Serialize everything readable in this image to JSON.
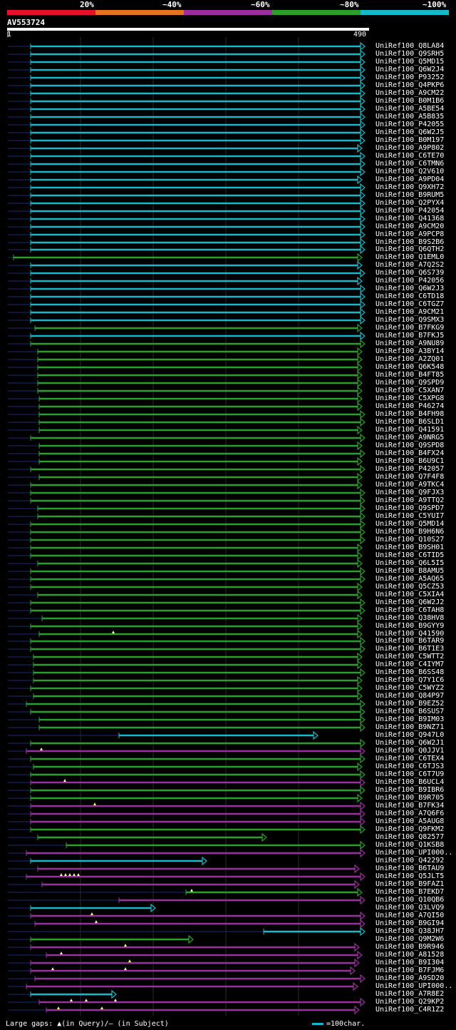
{
  "legend": {
    "colors": [
      "#e8102a",
      "#e8731e",
      "#9b2fa0",
      "#2aa02a",
      "#17b9c9"
    ],
    "labels": [
      "20%",
      "~40%",
      "~60%",
      "~80%",
      "~100%"
    ]
  },
  "query": {
    "name": "AV553724",
    "start": "1",
    "end": "490"
  },
  "footer": {
    "gaps_text": "Large gaps: ▲(in Query)/— (in Subject)",
    "scale_text": "=100char."
  },
  "hits": [
    {
      "label": "UniRef100_Q8LA84",
      "c": 4,
      "s": 43,
      "e": 512
    },
    {
      "label": "UniRef100_Q9SRH5",
      "c": 4,
      "s": 43,
      "e": 512
    },
    {
      "label": "UniRef100_Q5MD15",
      "c": 4,
      "s": 43,
      "e": 512
    },
    {
      "label": "UniRef100_Q6W2J4",
      "c": 4,
      "s": 43,
      "e": 512
    },
    {
      "label": "UniRef100_P93252",
      "c": 4,
      "s": 43,
      "e": 512
    },
    {
      "label": "UniRef100_Q4PKP6",
      "c": 4,
      "s": 43,
      "e": 512
    },
    {
      "label": "UniRef100_A9CM22",
      "c": 4,
      "s": 43,
      "e": 512
    },
    {
      "label": "UniRef100_B0M1B6",
      "c": 4,
      "s": 43,
      "e": 512
    },
    {
      "label": "UniRef100_A5BE54",
      "c": 4,
      "s": 43,
      "e": 512
    },
    {
      "label": "UniRef100_A5B835",
      "c": 4,
      "s": 43,
      "e": 512
    },
    {
      "label": "UniRef100_P42055",
      "c": 4,
      "s": 43,
      "e": 512
    },
    {
      "label": "UniRef100_Q6W2J5",
      "c": 4,
      "s": 43,
      "e": 512
    },
    {
      "label": "UniRef100_B0M197",
      "c": 4,
      "s": 43,
      "e": 512
    },
    {
      "label": "UniRef100_A9P802",
      "c": 4,
      "s": 43,
      "e": 508
    },
    {
      "label": "UniRef100_C6TE70",
      "c": 4,
      "s": 43,
      "e": 512
    },
    {
      "label": "UniRef100_C6TMN6",
      "c": 4,
      "s": 43,
      "e": 512
    },
    {
      "label": "UniRef100_Q2V610",
      "c": 4,
      "s": 43,
      "e": 512
    },
    {
      "label": "UniRef100_A9PD04",
      "c": 4,
      "s": 43,
      "e": 508
    },
    {
      "label": "UniRef100_Q9XH72",
      "c": 4,
      "s": 43,
      "e": 512
    },
    {
      "label": "UniRef100_B9RUM5",
      "c": 4,
      "s": 43,
      "e": 512
    },
    {
      "label": "UniRef100_Q2PYX4",
      "c": 4,
      "s": 43,
      "e": 512
    },
    {
      "label": "UniRef100_P42054",
      "c": 4,
      "s": 43,
      "e": 512
    },
    {
      "label": "UniRef100_Q41368",
      "c": 4,
      "s": 43,
      "e": 512
    },
    {
      "label": "UniRef100_A9CM20",
      "c": 4,
      "s": 43,
      "e": 512
    },
    {
      "label": "UniRef100_A9PCP8",
      "c": 4,
      "s": 43,
      "e": 512
    },
    {
      "label": "UniRef100_B9S2B6",
      "c": 4,
      "s": 43,
      "e": 512
    },
    {
      "label": "UniRef100_Q6QTH2",
      "c": 4,
      "s": 43,
      "e": 512
    },
    {
      "label": "UniRef100_Q1EML0",
      "c": 3,
      "s": 19,
      "e": 508
    },
    {
      "label": "UniRef100_A7Q2S2",
      "c": 4,
      "s": 43,
      "e": 508
    },
    {
      "label": "UniRef100_Q6S739",
      "c": 4,
      "s": 43,
      "e": 512
    },
    {
      "label": "UniRef100_P42056",
      "c": 4,
      "s": 43,
      "e": 508
    },
    {
      "label": "UniRef100_Q6W2J3",
      "c": 4,
      "s": 43,
      "e": 512
    },
    {
      "label": "UniRef100_C6TD18",
      "c": 4,
      "s": 43,
      "e": 512
    },
    {
      "label": "UniRef100_C6TGZ7",
      "c": 4,
      "s": 43,
      "e": 512
    },
    {
      "label": "UniRef100_A9CM21",
      "c": 4,
      "s": 43,
      "e": 512
    },
    {
      "label": "UniRef100_Q9SMX3",
      "c": 4,
      "s": 43,
      "e": 512
    },
    {
      "label": "UniRef100_B7FKG9",
      "c": 3,
      "s": 49,
      "e": 508
    },
    {
      "label": "UniRef100_B7FKJ5",
      "c": 4,
      "s": 43,
      "e": 512
    },
    {
      "label": "UniRef100_A9NU89",
      "c": 3,
      "s": 43,
      "e": 512
    },
    {
      "label": "UniRef100_A3BY14",
      "c": 3,
      "s": 53,
      "e": 508
    },
    {
      "label": "UniRef100_A2ZQ01",
      "c": 3,
      "s": 53,
      "e": 508
    },
    {
      "label": "UniRef100_Q6K548",
      "c": 3,
      "s": 53,
      "e": 508
    },
    {
      "label": "UniRef100_B4FT85",
      "c": 3,
      "s": 53,
      "e": 508
    },
    {
      "label": "UniRef100_Q9SPD9",
      "c": 3,
      "s": 53,
      "e": 508
    },
    {
      "label": "UniRef100_C5XAN7",
      "c": 3,
      "s": 53,
      "e": 508
    },
    {
      "label": "UniRef100_C5XPG8",
      "c": 3,
      "s": 55,
      "e": 508
    },
    {
      "label": "UniRef100_P46274",
      "c": 3,
      "s": 55,
      "e": 508
    },
    {
      "label": "UniRef100_B4FH98",
      "c": 3,
      "s": 55,
      "e": 512
    },
    {
      "label": "UniRef100_B6SLD1",
      "c": 3,
      "s": 55,
      "e": 512
    },
    {
      "label": "UniRef100_Q41591",
      "c": 3,
      "s": 55,
      "e": 508
    },
    {
      "label": "UniRef100_A9NRG5",
      "c": 3,
      "s": 43,
      "e": 512
    },
    {
      "label": "UniRef100_Q9SPD8",
      "c": 3,
      "s": 55,
      "e": 508
    },
    {
      "label": "UniRef100_B4FX24",
      "c": 3,
      "s": 55,
      "e": 512
    },
    {
      "label": "UniRef100_B6U9C1",
      "c": 3,
      "s": 55,
      "e": 508
    },
    {
      "label": "UniRef100_P42057",
      "c": 3,
      "s": 43,
      "e": 512
    },
    {
      "label": "UniRef100_Q7F4F8",
      "c": 3,
      "s": 55,
      "e": 508
    },
    {
      "label": "UniRef100_A9TKC4",
      "c": 3,
      "s": 43,
      "e": 508
    },
    {
      "label": "UniRef100_Q9FJX3",
      "c": 3,
      "s": 43,
      "e": 512
    },
    {
      "label": "UniRef100_A9TTQ2",
      "c": 3,
      "s": 43,
      "e": 512
    },
    {
      "label": "UniRef100_Q9SPD7",
      "c": 3,
      "s": 53,
      "e": 512
    },
    {
      "label": "UniRef100_C5YUI7",
      "c": 3,
      "s": 53,
      "e": 512
    },
    {
      "label": "UniRef100_Q5MD14",
      "c": 3,
      "s": 43,
      "e": 512
    },
    {
      "label": "UniRef100_B9H6N6",
      "c": 3,
      "s": 43,
      "e": 512
    },
    {
      "label": "UniRef100_Q10S27",
      "c": 3,
      "s": 43,
      "e": 512
    },
    {
      "label": "UniRef100_B9SH01",
      "c": 3,
      "s": 43,
      "e": 508
    },
    {
      "label": "UniRef100_C6TID5",
      "c": 3,
      "s": 43,
      "e": 508
    },
    {
      "label": "UniRef100_Q6L5I5",
      "c": 3,
      "s": 53,
      "e": 508
    },
    {
      "label": "UniRef100_B8AMU5",
      "c": 3,
      "s": 43,
      "e": 512
    },
    {
      "label": "UniRef100_A5AQ65",
      "c": 3,
      "s": 43,
      "e": 512
    },
    {
      "label": "UniRef100_Q5CZ53",
      "c": 3,
      "s": 43,
      "e": 508
    },
    {
      "label": "UniRef100_C5XIA4",
      "c": 3,
      "s": 53,
      "e": 508
    },
    {
      "label": "UniRef100_Q6W2J2",
      "c": 3,
      "s": 43,
      "e": 512
    },
    {
      "label": "UniRef100_C6TAH8",
      "c": 3,
      "s": 43,
      "e": 512
    },
    {
      "label": "UniRef100_Q38HV8",
      "c": 3,
      "s": 59,
      "e": 508
    },
    {
      "label": "UniRef100_B9GYY9",
      "c": 3,
      "s": 43,
      "e": 508
    },
    {
      "label": "UniRef100_Q41590",
      "c": 3,
      "s": 55,
      "e": 508,
      "mk": [
        159
      ]
    },
    {
      "label": "UniRef100_B6TAR9",
      "c": 3,
      "s": 43,
      "e": 512
    },
    {
      "label": "UniRef100_B6T1E3",
      "c": 3,
      "s": 43,
      "e": 512
    },
    {
      "label": "UniRef100_C5WTT2",
      "c": 3,
      "s": 47,
      "e": 508
    },
    {
      "label": "UniRef100_C4IYM7",
      "c": 3,
      "s": 47,
      "e": 508
    },
    {
      "label": "UniRef100_B6SS48",
      "c": 3,
      "s": 47,
      "e": 512
    },
    {
      "label": "UniRef100_Q7Y1C6",
      "c": 3,
      "s": 47,
      "e": 508
    },
    {
      "label": "UniRef100_C5WYZ2",
      "c": 3,
      "s": 43,
      "e": 508
    },
    {
      "label": "UniRef100_Q84P97",
      "c": 3,
      "s": 47,
      "e": 508
    },
    {
      "label": "UniRef100_B9EZ52",
      "c": 3,
      "s": 37,
      "e": 512
    },
    {
      "label": "UniRef100_B6SUS7",
      "c": 3,
      "s": 43,
      "e": 512
    },
    {
      "label": "UniRef100_B9IM03",
      "c": 3,
      "s": 55,
      "e": 512
    },
    {
      "label": "UniRef100_B9NZ71",
      "c": 3,
      "s": 55,
      "e": 512
    },
    {
      "label": "UniRef100_Q947L0",
      "c": 4,
      "s": 167,
      "e": 446
    },
    {
      "label": "UniRef100_Q6W2J1",
      "c": 3,
      "s": 43,
      "e": 512
    },
    {
      "label": "UniRef100_Q0JJV1",
      "c": 2,
      "s": 37,
      "e": 512,
      "mk": [
        58
      ]
    },
    {
      "label": "UniRef100_C6TEX4",
      "c": 3,
      "s": 43,
      "e": 512
    },
    {
      "label": "UniRef100_C6TJS3",
      "c": 3,
      "s": 47,
      "e": 508
    },
    {
      "label": "UniRef100_C6T7U9",
      "c": 3,
      "s": 43,
      "e": 512
    },
    {
      "label": "UniRef100_B6UCL4",
      "c": 2,
      "s": 43,
      "e": 512,
      "mk": [
        91
      ]
    },
    {
      "label": "UniRef100_B9IBR6",
      "c": 3,
      "s": 43,
      "e": 512
    },
    {
      "label": "UniRef100_B9R705",
      "c": 3,
      "s": 43,
      "e": 508
    },
    {
      "label": "UniRef100_B7FK34",
      "c": 2,
      "s": 43,
      "e": 512,
      "mk": [
        133
      ]
    },
    {
      "label": "UniRef100_A7Q6F6",
      "c": 2,
      "s": 43,
      "e": 512
    },
    {
      "label": "UniRef100_A5AUG8",
      "c": 2,
      "s": 43,
      "e": 512
    },
    {
      "label": "UniRef100_Q9FKM2",
      "c": 3,
      "s": 43,
      "e": 512
    },
    {
      "label": "UniRef100_Q82577",
      "c": 3,
      "s": 53,
      "e": 374
    },
    {
      "label": "UniRef100_Q1KSB8",
      "c": 3,
      "s": 93,
      "e": 512
    },
    {
      "label": "UniRef100_UPI000..",
      "c": 2,
      "s": 37,
      "e": 512
    },
    {
      "label": "UniRef100_Q42292",
      "c": 4,
      "s": 43,
      "e": 290
    },
    {
      "label": "UniRef100_B6TAU9",
      "c": 2,
      "s": 53,
      "e": 504
    },
    {
      "label": "UniRef100_Q5JLT5",
      "c": 2,
      "s": 37,
      "e": 512,
      "mk": [
        86,
        92,
        98,
        104,
        110
      ]
    },
    {
      "label": "UniRef100_B9FAZ1",
      "c": 2,
      "s": 59,
      "e": 504
    },
    {
      "label": "UniRef100_B7EKD7",
      "c": 3,
      "s": 261,
      "e": 508,
      "mk": [
        269
      ]
    },
    {
      "label": "UniRef100_Q10QB6",
      "c": 2,
      "s": 167,
      "e": 512
    },
    {
      "label": "UniRef100_Q3LVQ9",
      "c": 4,
      "s": 43,
      "e": 218
    },
    {
      "label": "UniRef100_A7QI50",
      "c": 2,
      "s": 43,
      "e": 512,
      "mk": [
        129
      ]
    },
    {
      "label": "UniRef100_B9GI94",
      "c": 2,
      "s": 49,
      "e": 512,
      "mk": [
        135
      ]
    },
    {
      "label": "UniRef100_Q38JH7",
      "c": 4,
      "s": 370,
      "e": 512
    },
    {
      "label": "UniRef100_Q9M2W6",
      "c": 3,
      "s": 43,
      "e": 271
    },
    {
      "label": "UniRef100_B9R946",
      "c": 2,
      "s": 43,
      "e": 504,
      "mk": [
        176
      ]
    },
    {
      "label": "UniRef100_A81528",
      "c": 2,
      "s": 65,
      "e": 508,
      "mk": [
        86
      ]
    },
    {
      "label": "UniRef100_B9I304",
      "c": 2,
      "s": 43,
      "e": 504,
      "mk": [
        182
      ]
    },
    {
      "label": "UniRef100_B7FJM6",
      "c": 2,
      "s": 43,
      "e": 498,
      "mk": [
        74,
        176
      ]
    },
    {
      "label": "UniRef100_A9SD20",
      "c": 2,
      "s": 49,
      "e": 512
    },
    {
      "label": "UniRef100_UPI000..",
      "c": 2,
      "s": 37,
      "e": 502
    },
    {
      "label": "UniRef100_A7R8E2",
      "c": 4,
      "s": 43,
      "e": 163
    },
    {
      "label": "UniRef100_Q29KP2",
      "c": 2,
      "s": 55,
      "e": 512,
      "mk": [
        100,
        121,
        162
      ]
    },
    {
      "label": "UniRef100_C4R1Z2",
      "c": 2,
      "s": 65,
      "e": 504,
      "mk": [
        82,
        143
      ]
    }
  ]
}
